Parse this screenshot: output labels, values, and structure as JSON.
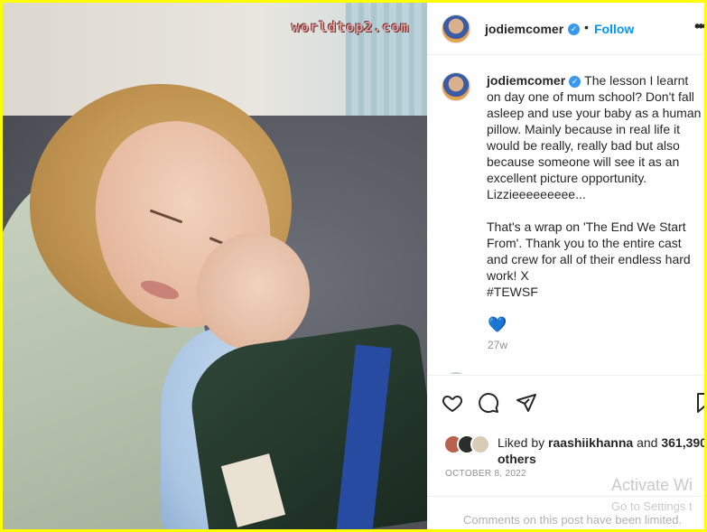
{
  "watermark": "worldtop2.com",
  "post": {
    "username": "jodiemcomer",
    "follow_label": "Follow",
    "separator": "•",
    "more_label": "•••",
    "caption_line1": "The lesson I learnt on day one of mum school? Don't fall asleep and use your baby as a human pillow. Mainly because in real life it would be really, really bad but also because someone will see it as an excellent picture opportunity. Lizzieeeeeeeee...",
    "caption_line2": "That's a wrap on 'The End We Start From'. Thank you to the entire cast and crew for all of their endless hard work! X",
    "hashtag": "#TEWSF",
    "reaction_emoji": "💙",
    "age": "27w",
    "liked_by_prefix": "Liked by",
    "liked_by_user": "raashiikhanna",
    "liked_by_middle": "and",
    "likes_count": "361,390",
    "likes_suffix": "others",
    "date": "OCTOBER 8, 2022",
    "comments_notice": "Comments on this post have been limited."
  },
  "icons": {
    "like": "heart-outline-icon",
    "comment": "comment-bubble-icon",
    "share": "paper-plane-icon",
    "save": "bookmark-icon",
    "verified": "verified-badge-icon"
  },
  "overlay": {
    "activate_title": "Activate Wi",
    "activate_sub": "Go to Settings t"
  },
  "colors": {
    "frame": "#ffff00",
    "link": "#0095f6",
    "verified": "#3897f0"
  }
}
